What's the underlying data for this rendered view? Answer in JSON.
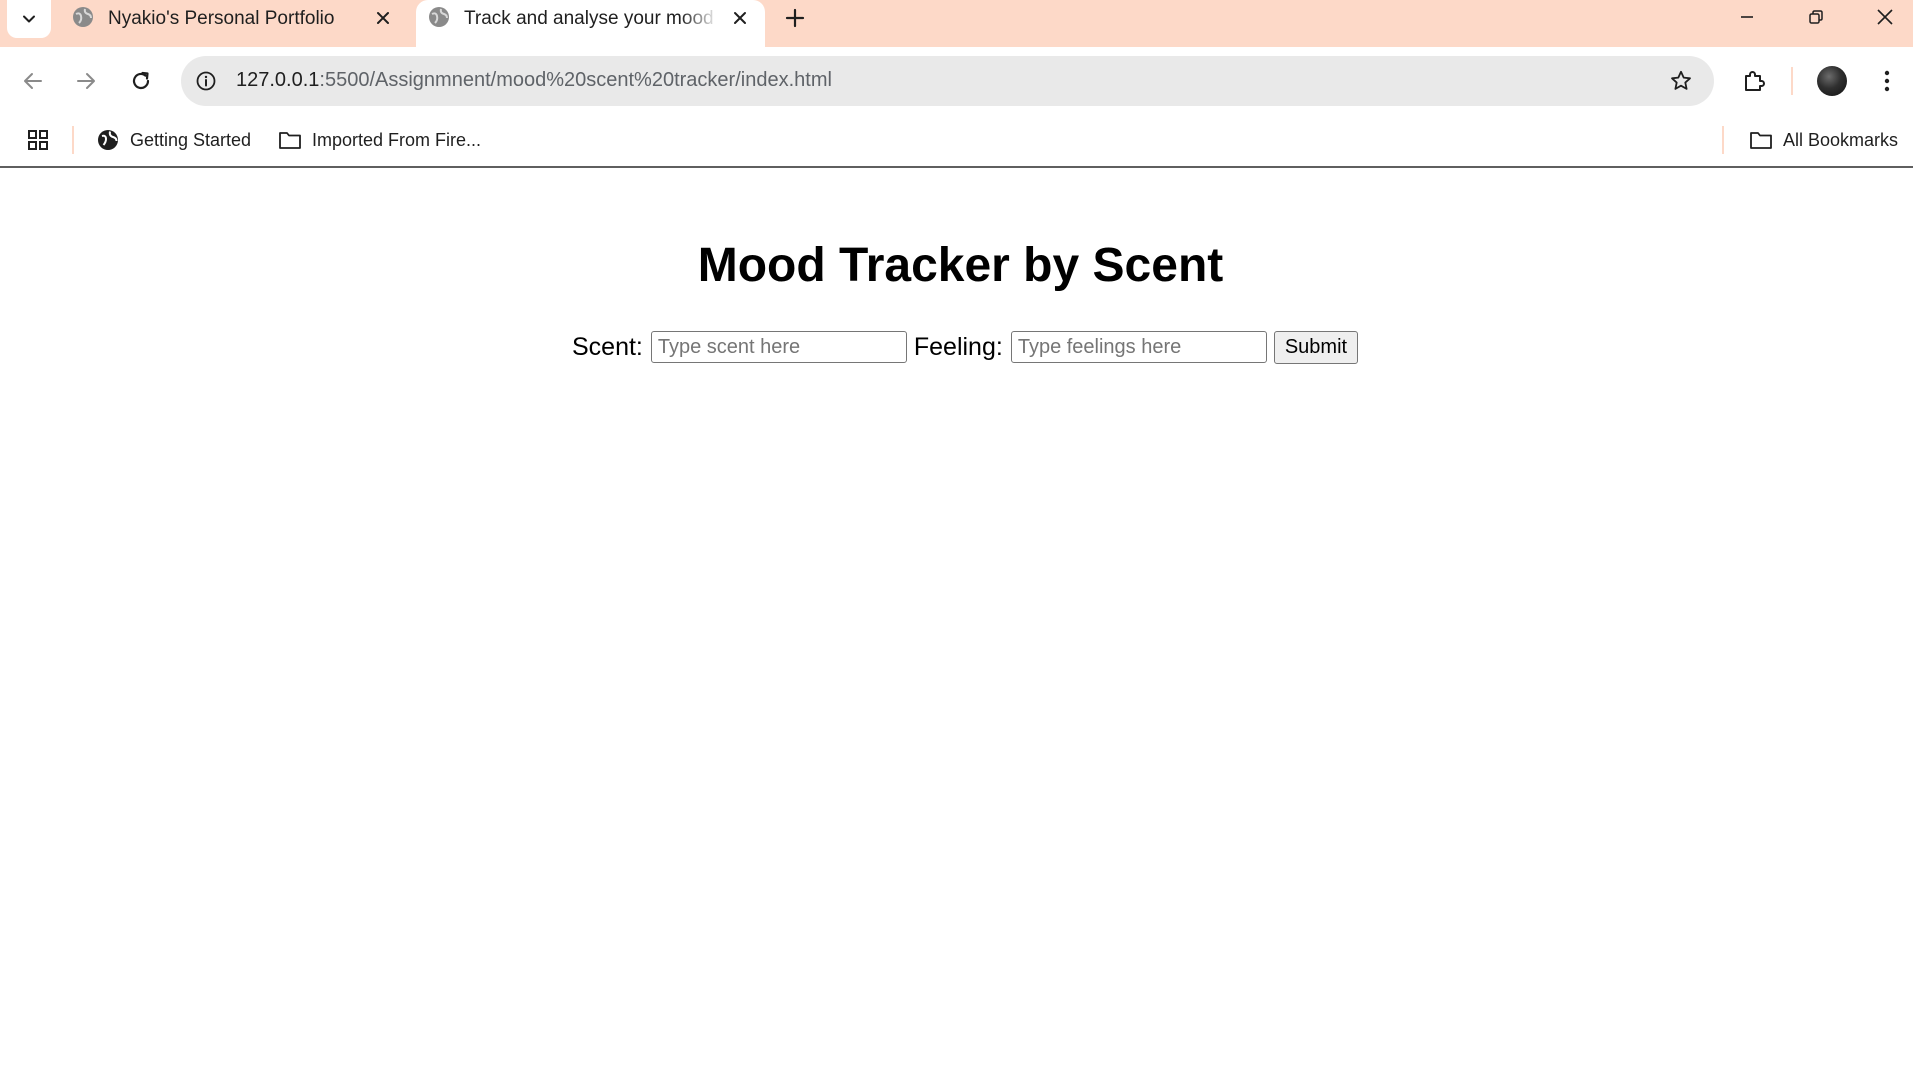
{
  "browser": {
    "tabs": [
      {
        "title": "Nyakio's Personal Portfolio",
        "active": false
      },
      {
        "title": "Track and analyse your mood by scent",
        "active": true
      }
    ],
    "url_host": "127.0.0.1",
    "url_path": ":5500/Assignmnent/mood%20scent%20tracker/index.html",
    "bookmarks": [
      {
        "label": "Getting Started",
        "icon": "globe-icon"
      },
      {
        "label": "Imported From Fire...",
        "icon": "folder-icon"
      }
    ],
    "all_bookmarks_label": "All Bookmarks",
    "colors": {
      "tabstrip": "#fdd9c8",
      "omnibox": "#e9e9e9"
    }
  },
  "page": {
    "title": "Mood Tracker by Scent",
    "scent_label": "Scent:",
    "scent_placeholder": "Type scent here",
    "feeling_label": "Feeling:",
    "feeling_placeholder": "Type feelings here",
    "submit_label": "Submit"
  }
}
